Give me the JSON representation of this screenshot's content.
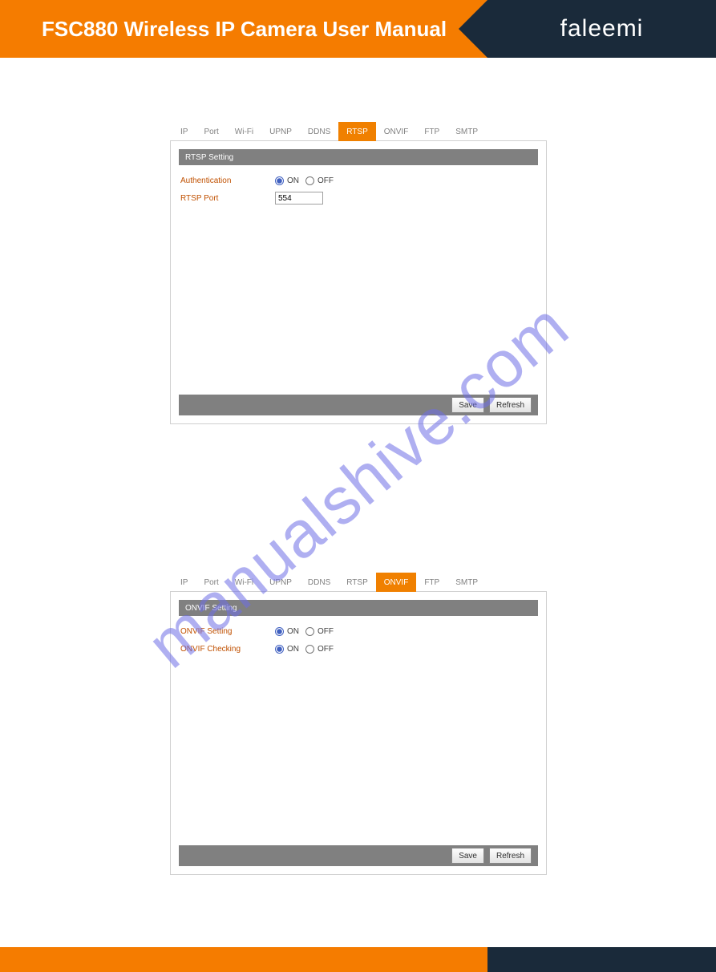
{
  "header": {
    "title": "FSC880 Wireless IP Camera User Manual",
    "brand": "faleemi"
  },
  "watermark": "manualshive.com",
  "tabs": [
    "IP",
    "Port",
    "Wi-Fi",
    "UPNP",
    "DDNS",
    "RTSP",
    "ONVIF",
    "FTP",
    "SMTP"
  ],
  "panel_rtsp": {
    "active_tab": "RTSP",
    "section_title": "RTSP Setting",
    "rows": {
      "auth_label": "Authentication",
      "port_label": "RTSP Port",
      "port_value": "554"
    }
  },
  "panel_onvif": {
    "active_tab": "ONVIF",
    "section_title": "ONVIF Setting",
    "rows": {
      "setting_label": "ONVIF Setting",
      "checking_label": "ONVIF Checking"
    }
  },
  "radio": {
    "on": "ON",
    "off": "OFF"
  },
  "buttons": {
    "save": "Save",
    "refresh": "Refresh"
  }
}
